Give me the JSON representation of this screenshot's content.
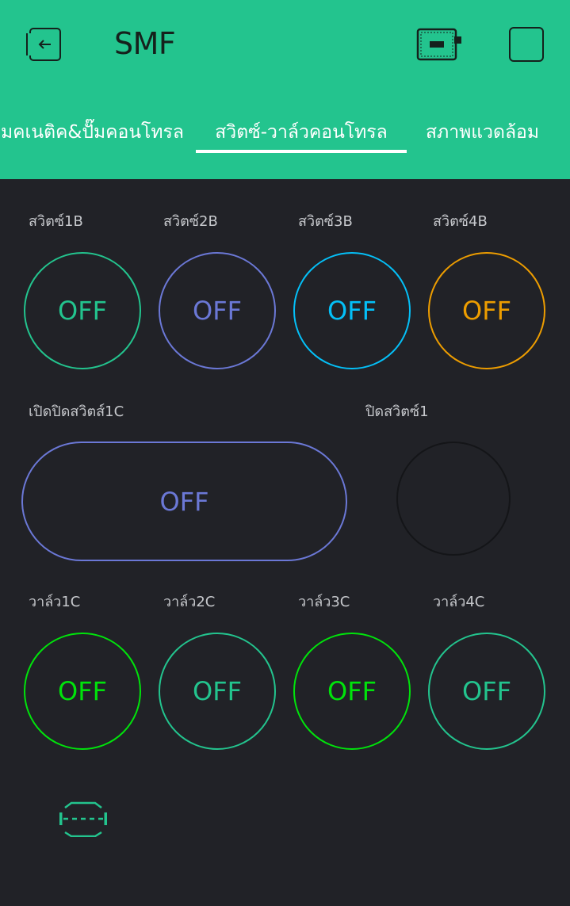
{
  "header": {
    "title": "SMF",
    "bg_color": "#23c48e"
  },
  "tabs": [
    {
      "label": "แมคเนติค&ปั๊มคอนโทรล",
      "active": false
    },
    {
      "label": "สวิตซ์-วาล์วคอนโทรล",
      "active": true
    },
    {
      "label": "สภาพแวดล้อม",
      "active": false
    }
  ],
  "switches_row": [
    {
      "label": "สวิตซ์1B",
      "state": "OFF",
      "color": "#23c48e"
    },
    {
      "label": "สวิตซ์2B",
      "state": "OFF",
      "color": "#6b78d6"
    },
    {
      "label": "สวิตซ์3B",
      "state": "OFF",
      "color": "#04c0f8"
    },
    {
      "label": "สวิตซ์4B",
      "state": "OFF",
      "color": "#ed9d00"
    }
  ],
  "toggle_1c": {
    "label": "เปิดปิดสวิตส์1C",
    "state": "OFF",
    "color": "#6b78d6"
  },
  "close_switch_1": {
    "label": "ปิดสวิตซ์1"
  },
  "valves_row": [
    {
      "label": "วาล์ว1C",
      "state": "OFF",
      "color": "#00e30b"
    },
    {
      "label": "วาล์ว2C",
      "state": "OFF",
      "color": "#23c48e"
    },
    {
      "label": "วาล์ว3C",
      "state": "OFF",
      "color": "#00e30b"
    },
    {
      "label": "วาล์ว4C",
      "state": "OFF",
      "color": "#23c48e"
    }
  ],
  "icons": {
    "back": "exit-icon",
    "device": "device-board-icon",
    "menu": "square-icon",
    "spacer": "spacer-icon"
  }
}
